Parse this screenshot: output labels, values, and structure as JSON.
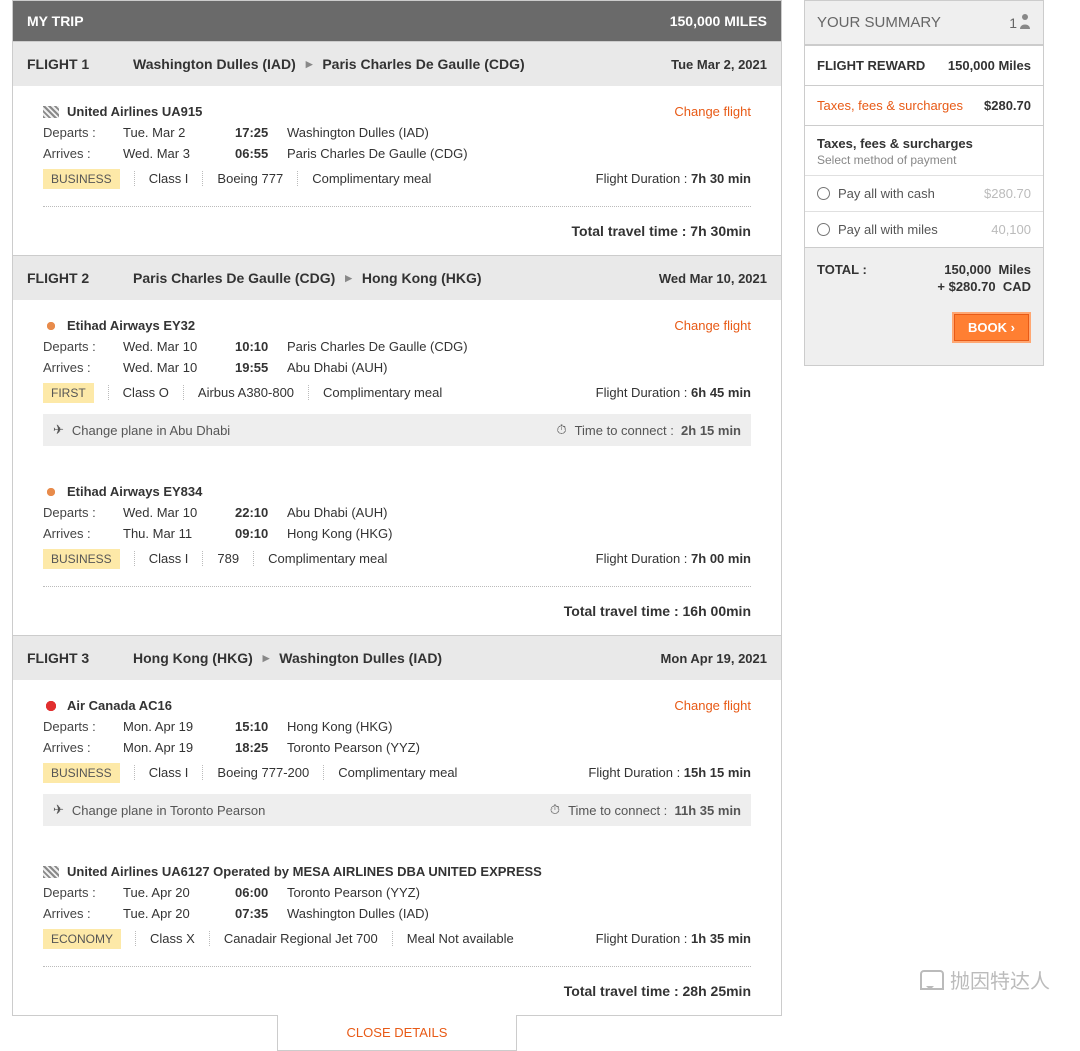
{
  "header": {
    "title": "MY TRIP",
    "total_miles": "150,000 MILES"
  },
  "labels": {
    "departs": "Departs :",
    "arrives": "Arrives :",
    "flight_duration": "Flight Duration :",
    "total_travel_time": "Total travel time :",
    "time_to_connect": "Time to connect :",
    "close_details": "CLOSE DETAILS",
    "change_flight": "Change flight"
  },
  "flights": [
    {
      "label": "FLIGHT 1",
      "from": "Washington Dulles (IAD)",
      "to": "Paris Charles De Gaulle (CDG)",
      "date": "Tue Mar 2, 2021",
      "total": "7h 30min",
      "segments": [
        {
          "logo": "united",
          "airline": "United Airlines UA915",
          "dep_date": "Tue. Mar 2",
          "dep_time": "17:25",
          "dep_loc": "Washington Dulles (IAD)",
          "arr_date": "Wed. Mar 3",
          "arr_time": "06:55",
          "arr_loc": "Paris Charles De Gaulle (CDG)",
          "cabin": "BUSINESS",
          "class": "Class I",
          "aircraft": "Boeing 777",
          "meal": "Complimentary meal",
          "duration": "7h 30 min"
        }
      ]
    },
    {
      "label": "FLIGHT 2",
      "from": "Paris Charles De Gaulle (CDG)",
      "to": "Hong Kong (HKG)",
      "date": "Wed Mar 10, 2021",
      "total": "16h 00min",
      "segments": [
        {
          "logo": "etihad",
          "airline": "Etihad Airways EY32",
          "dep_date": "Wed. Mar 10",
          "dep_time": "10:10",
          "dep_loc": "Paris Charles De Gaulle (CDG)",
          "arr_date": "Wed. Mar 10",
          "arr_time": "19:55",
          "arr_loc": "Abu Dhabi (AUH)",
          "cabin": "FIRST",
          "class": "Class O",
          "aircraft": "Airbus A380-800",
          "meal": "Complimentary meal",
          "duration": "6h 45 min",
          "connection": {
            "text": "Change plane in Abu Dhabi",
            "time": "2h 15 min"
          }
        },
        {
          "logo": "etihad",
          "airline": "Etihad Airways EY834",
          "dep_date": "Wed. Mar 10",
          "dep_time": "22:10",
          "dep_loc": "Abu Dhabi (AUH)",
          "arr_date": "Thu. Mar 11",
          "arr_time": "09:10",
          "arr_loc": "Hong Kong (HKG)",
          "cabin": "BUSINESS",
          "class": "Class I",
          "aircraft": "789",
          "meal": "Complimentary meal",
          "duration": "7h 00 min"
        }
      ]
    },
    {
      "label": "FLIGHT 3",
      "from": "Hong Kong (HKG)",
      "to": "Washington Dulles (IAD)",
      "date": "Mon Apr 19, 2021",
      "total": "28h 25min",
      "segments": [
        {
          "logo": "aircanada",
          "airline": "Air Canada AC16",
          "dep_date": "Mon. Apr 19",
          "dep_time": "15:10",
          "dep_loc": "Hong Kong (HKG)",
          "arr_date": "Mon. Apr 19",
          "arr_time": "18:25",
          "arr_loc": "Toronto Pearson (YYZ)",
          "cabin": "BUSINESS",
          "class": "Class I",
          "aircraft": "Boeing 777-200",
          "meal": "Complimentary meal",
          "duration": "15h 15 min",
          "connection": {
            "text": "Change plane in Toronto Pearson",
            "time": "11h 35 min"
          }
        },
        {
          "logo": "united",
          "airline": "United Airlines UA6127 Operated by MESA AIRLINES DBA UNITED EXPRESS",
          "dep_date": "Tue. Apr 20",
          "dep_time": "06:00",
          "dep_loc": "Toronto Pearson (YYZ)",
          "arr_date": "Tue. Apr 20",
          "arr_time": "07:35",
          "arr_loc": "Washington Dulles (IAD)",
          "cabin": "ECONOMY",
          "class": "Class X",
          "aircraft": "Canadair Regional Jet 700",
          "meal": "Meal Not available",
          "duration": "1h 35 min"
        }
      ]
    }
  ],
  "summary": {
    "title": "YOUR SUMMARY",
    "pax": "1",
    "reward_label": "FLIGHT REWARD",
    "reward_value": "150,000 Miles",
    "taxes_label": "Taxes, fees & surcharges",
    "taxes_value": "$280.70",
    "pay_title": "Taxes, fees & surcharges",
    "pay_sub": "Select method of payment",
    "pay_cash_label": "Pay all with cash",
    "pay_cash_value": "$280.70",
    "pay_miles_label": "Pay all with miles",
    "pay_miles_value": "40,100",
    "total_label": "TOTAL :",
    "total_miles": "150,000",
    "total_miles_unit": "Miles",
    "total_cash": "+ $280.70",
    "total_cash_unit": "CAD",
    "book": "BOOK"
  },
  "watermark": "抛因特达人"
}
